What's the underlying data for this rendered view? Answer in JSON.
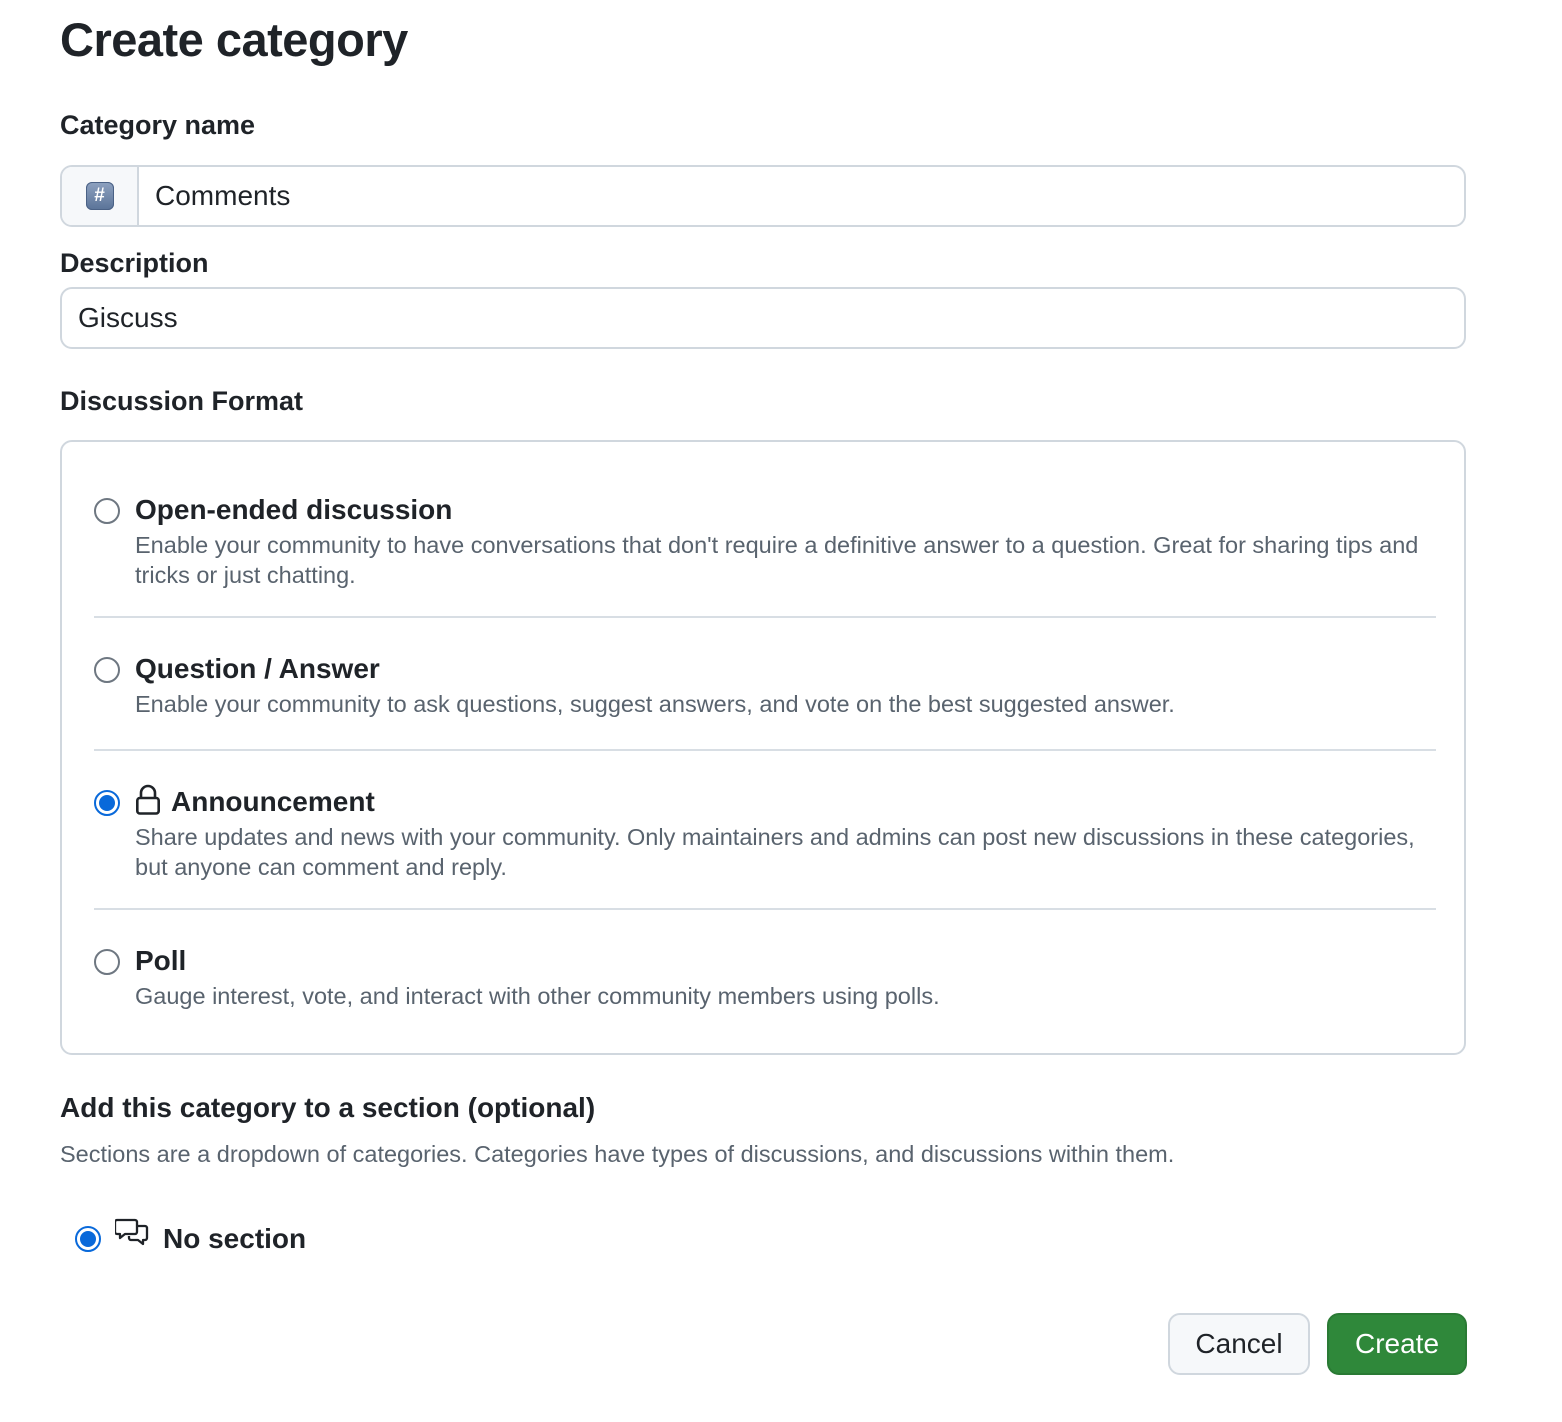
{
  "page": {
    "title": "Create category"
  },
  "category_name": {
    "label": "Category name",
    "emoji_symbol": "#",
    "value": "Comments"
  },
  "description": {
    "label": "Description",
    "value": "Giscuss"
  },
  "discussion_format": {
    "label": "Discussion Format",
    "selected": "Announcement",
    "options": [
      {
        "title": "Open-ended discussion",
        "description": "Enable your community to have conversations that don't require a definitive answer to a question. Great for sharing tips and tricks or just chatting.",
        "checked": false
      },
      {
        "title": "Question / Answer",
        "description": "Enable your community to ask questions, suggest answers, and vote on the best suggested answer.",
        "checked": false
      },
      {
        "title": "Announcement",
        "description": "Share updates and news with your community. Only maintainers and admins can post new discussions in these categories, but anyone can comment and reply.",
        "checked": true,
        "icon": "lock-icon"
      },
      {
        "title": "Poll",
        "description": "Gauge interest, vote, and interact with other community members using polls.",
        "checked": false
      }
    ]
  },
  "section": {
    "title": "Add this category to a section (optional)",
    "description": "Sections are a dropdown of categories. Categories have types of discussions, and discussions within them.",
    "option_label": "No section",
    "option_icon": "comment-discussion-icon",
    "checked": true
  },
  "actions": {
    "cancel_label": "Cancel",
    "create_label": "Create"
  },
  "colors": {
    "accent": "#0969da",
    "primary_button": "#2f883a",
    "border": "#d0d7de",
    "muted_text": "#59636e"
  }
}
